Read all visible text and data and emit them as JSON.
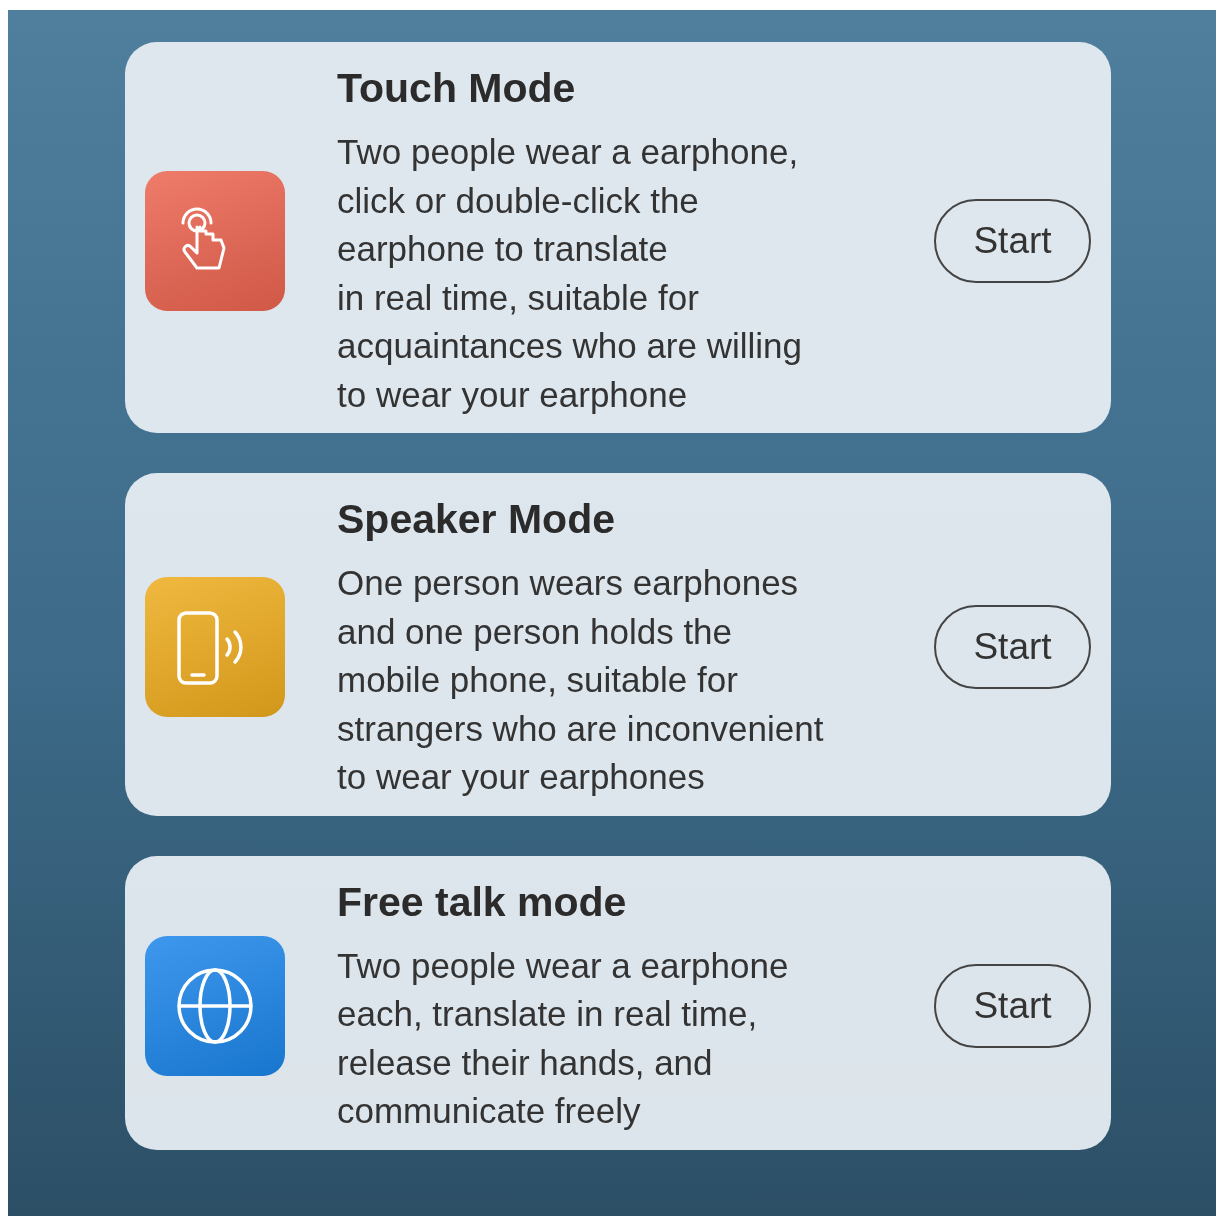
{
  "modes": [
    {
      "kind": "touch",
      "color": "#ec6450",
      "title": "Touch Mode",
      "description": "Two people wear a earphone,\nclick or double-click the\nearphone to translate\nin real time, suitable for\nacquaintances who are willing\nto wear your earphone",
      "button": "Start"
    },
    {
      "kind": "speaker",
      "color": "#eeac1e",
      "title": "Speaker Mode",
      "description": "One person wears earphones\nand one person holds the\nmobile phone, suitable for\nstrangers who are inconvenient\nto wear your earphones",
      "button": "Start"
    },
    {
      "kind": "globe",
      "color": "#1c86ea",
      "title": "Free talk mode",
      "description": "Two people wear a earphone\neach, translate in real time,\nrelease their hands, and\ncommunicate freely",
      "button": "Start"
    }
  ]
}
